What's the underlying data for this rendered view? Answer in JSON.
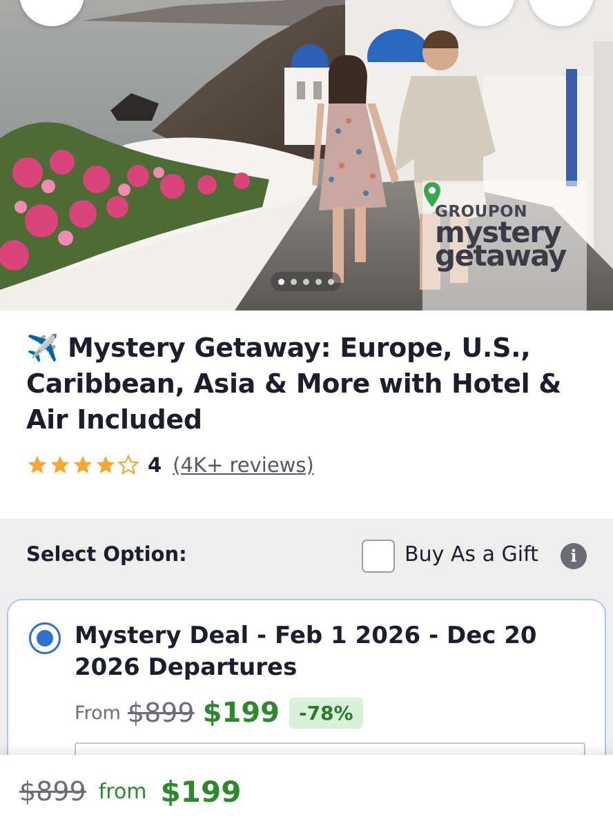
{
  "hero": {
    "image_alt": "Couple walking in Santorini",
    "carousel": {
      "count": 5,
      "active": 0
    },
    "logo": {
      "line1": "GROUPON",
      "line2": "mystery",
      "line3": "getaway"
    }
  },
  "deal": {
    "title": "Mystery Getaway: Europe, U.S., Caribbean, Asia & More with Hotel & Air Included",
    "title_icon": "✈️",
    "rating": {
      "stars": 4,
      "value": "4",
      "reviews": "(4K+ reviews)"
    }
  },
  "options": {
    "select_label": "Select Option:",
    "gift_label": "Buy As a Gift",
    "gift_checked": false,
    "info_icon": "i",
    "items": [
      {
        "title": "Mystery Deal - Feb 1 2026 - Dec 20 2026 Departures",
        "selected": true,
        "from_label": "From",
        "original_price": "$899",
        "price": "$199",
        "discount": "-78%"
      }
    ]
  },
  "bottom_bar": {
    "original_price": "$899",
    "from_label": "from",
    "price": "$199"
  },
  "colors": {
    "price_green": "#2c8a2c",
    "radio_blue": "#2f6fd1",
    "star_orange": "#f4a831"
  }
}
